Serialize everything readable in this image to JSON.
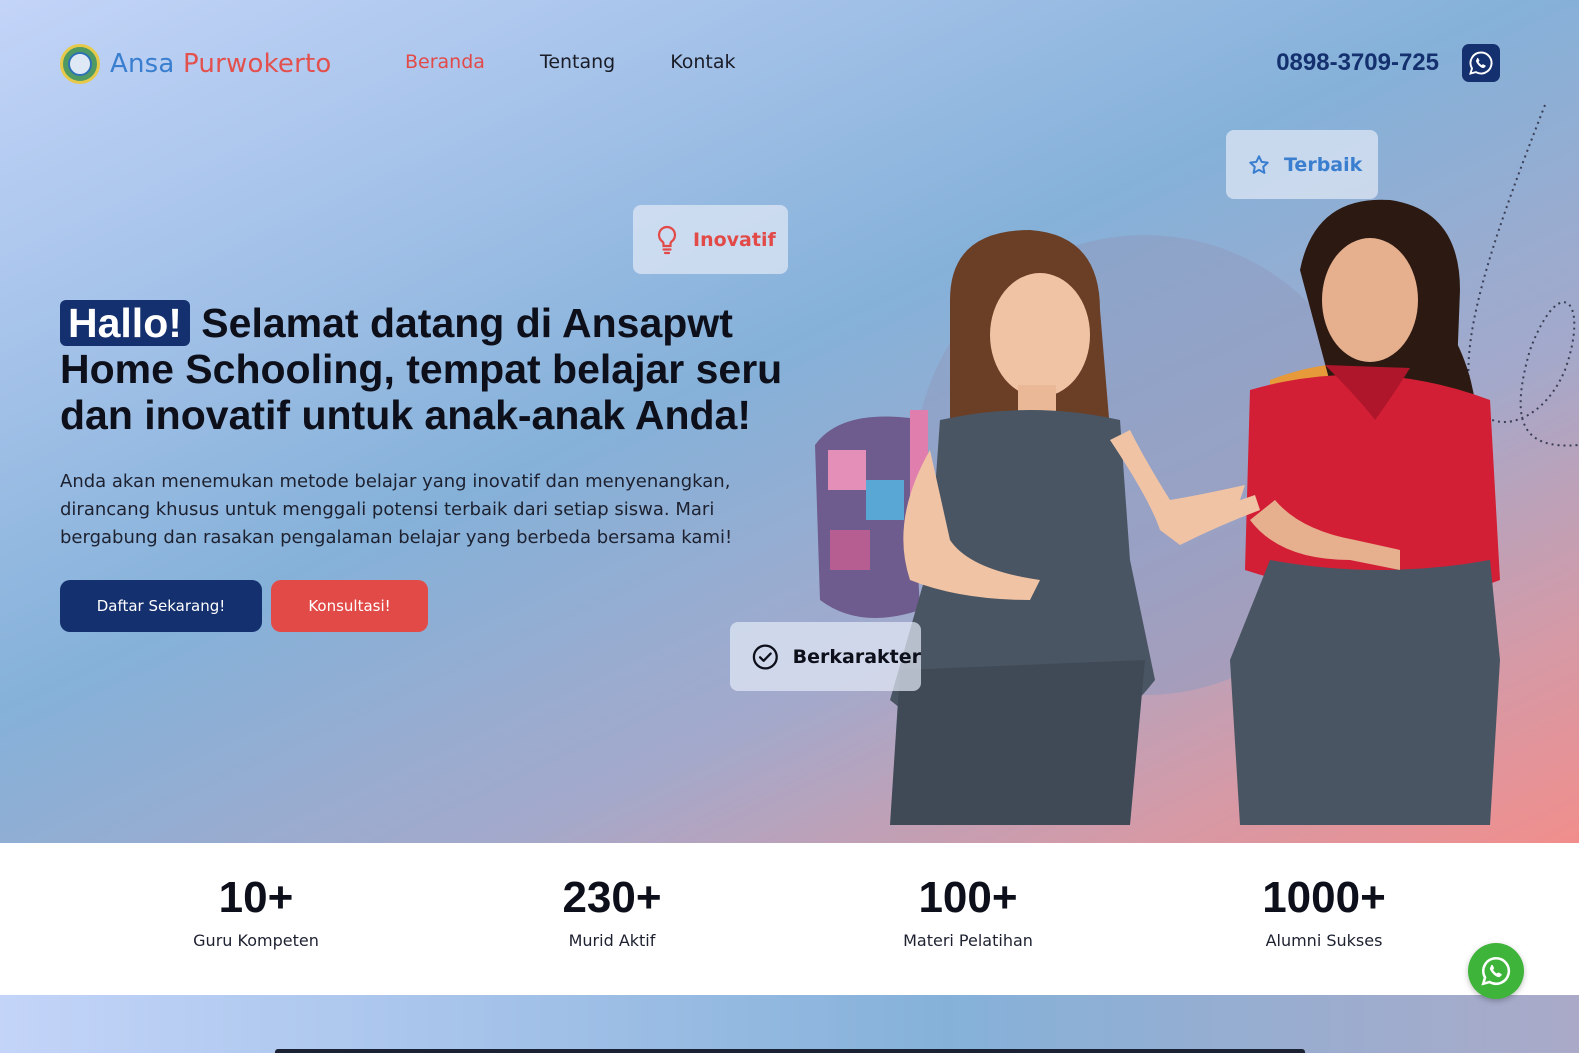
{
  "header": {
    "brand_part1": "Ansa",
    "brand_part2": "Purwokerto",
    "nav": [
      {
        "label": "Beranda",
        "active": true
      },
      {
        "label": "Tentang",
        "active": false
      },
      {
        "label": "Kontak",
        "active": false
      }
    ],
    "phone": "0898-3709-725",
    "whatsapp_icon": "whatsapp-icon"
  },
  "hero": {
    "highlight": "Hallo!",
    "title_rest": " Selamat datang di Ansapwt Home Schooling, tempat belajar seru dan inovatif untuk anak-anak Anda!",
    "subtitle": "Anda akan menemukan metode belajar yang inovatif dan menyenangkan, dirancang khusus untuk menggali potensi terbaik dari setiap siswa. Mari bergabung dan rasakan pengalaman belajar yang berbeda bersama kami!",
    "primary_button": "Daftar Sekarang!",
    "secondary_button": "Konsultasi!",
    "chips": {
      "inovatif": "Inovatif",
      "terbaik": "Terbaik",
      "berkarakter": "Berkarakter"
    }
  },
  "stats": [
    {
      "value": "10+",
      "label": "Guru Kompeten"
    },
    {
      "value": "230+",
      "label": "Murid Aktif"
    },
    {
      "value": "100+",
      "label": "Materi Pelatihan"
    },
    {
      "value": "1000+",
      "label": "Alumni Sukses"
    }
  ],
  "colors": {
    "navy": "#14306e",
    "red": "#e24a48",
    "blue": "#3a7ecf",
    "whatsapp_green": "#3fb43a"
  }
}
